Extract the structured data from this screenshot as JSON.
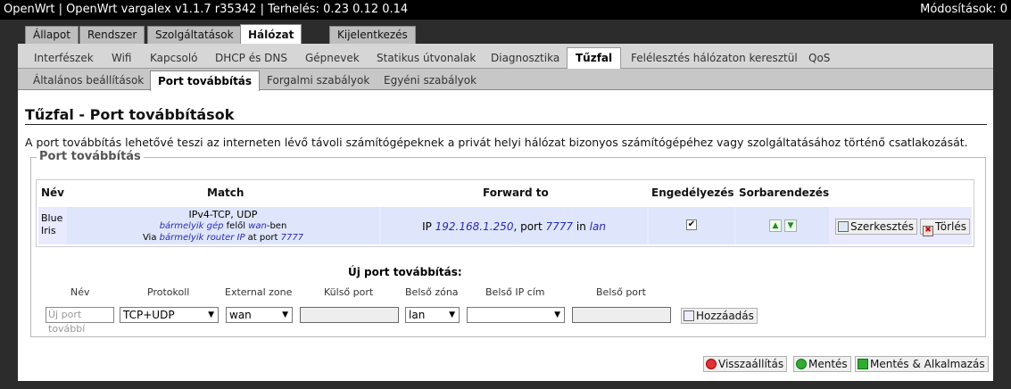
{
  "header": {
    "title": "OpenWrt | OpenWrt vargalex v1.1.7 r35342 | Terhelés: 0.23 0.12 0.14",
    "changes": "Módosítások: 0"
  },
  "tabs1": [
    "Állapot",
    "Rendszer",
    "Szolgáltatások",
    "Hálózat",
    "Kijelentkezés"
  ],
  "tabs2": [
    "Interfészek",
    "Wifi",
    "Kapcsoló",
    "DHCP és DNS",
    "Gépnevek",
    "Statikus útvonalak",
    "Diagnosztika",
    "Tűzfal",
    "Felélesztés hálózaton keresztül",
    "QoS"
  ],
  "tabs3": [
    "Általános beállítások",
    "Port továbbítás",
    "Forgalmi szabályok",
    "Egyéni szabályok"
  ],
  "page": {
    "title": "Tűzfal - Port továbbítások",
    "description": "A port továbbítás lehetővé teszi az interneten lévő távoli számítógépeknek a privát helyi hálózat bizonyos számítógépéhez vagy szolgáltatásához történő csatlakozását."
  },
  "section": {
    "legend": "Port továbbítás",
    "columns": {
      "name": "Név",
      "match": "Match",
      "forward": "Forward to",
      "enable": "Engedélyezés",
      "sort": "Sorbarendezés"
    },
    "row": {
      "name_line1": "Blue",
      "name_line2": "Iris",
      "match_line1": "IPv4-TCP, UDP",
      "match_line2_a": "bármelyik gép",
      "match_line2_b": " felől ",
      "match_line2_c": "wan",
      "match_line2_d": "-ben",
      "match_line3_a": "Via ",
      "match_line3_b": "bármelyik router IP",
      "match_line3_c": " at port ",
      "match_line3_d": "7777",
      "fwd_a": "IP ",
      "fwd_b": "192.168.1.250",
      "fwd_c": ", port ",
      "fwd_d": "7777",
      "fwd_e": " in ",
      "fwd_f": "lan",
      "enabled": true,
      "edit_label": "Szerkesztés",
      "delete_label": "Törlés"
    },
    "new": {
      "heading": "Új port továbbítás:",
      "labels": {
        "name": "Név",
        "protocol": "Protokoll",
        "ext_zone": "External zone",
        "ext_port": "Külső port",
        "int_zone": "Belső zóna",
        "int_ip": "Belső IP cím",
        "int_port": "Belső port"
      },
      "name_placeholder": "Új port továbbí",
      "protocol": "TCP+UDP",
      "ext_zone": "wan",
      "int_zone": "lan",
      "int_ip": "",
      "add_label": "Hozzáadás"
    }
  },
  "footer": {
    "reset": "Visszaállítás",
    "save": "Mentés",
    "save_apply": "Mentés & Alkalmazás"
  }
}
